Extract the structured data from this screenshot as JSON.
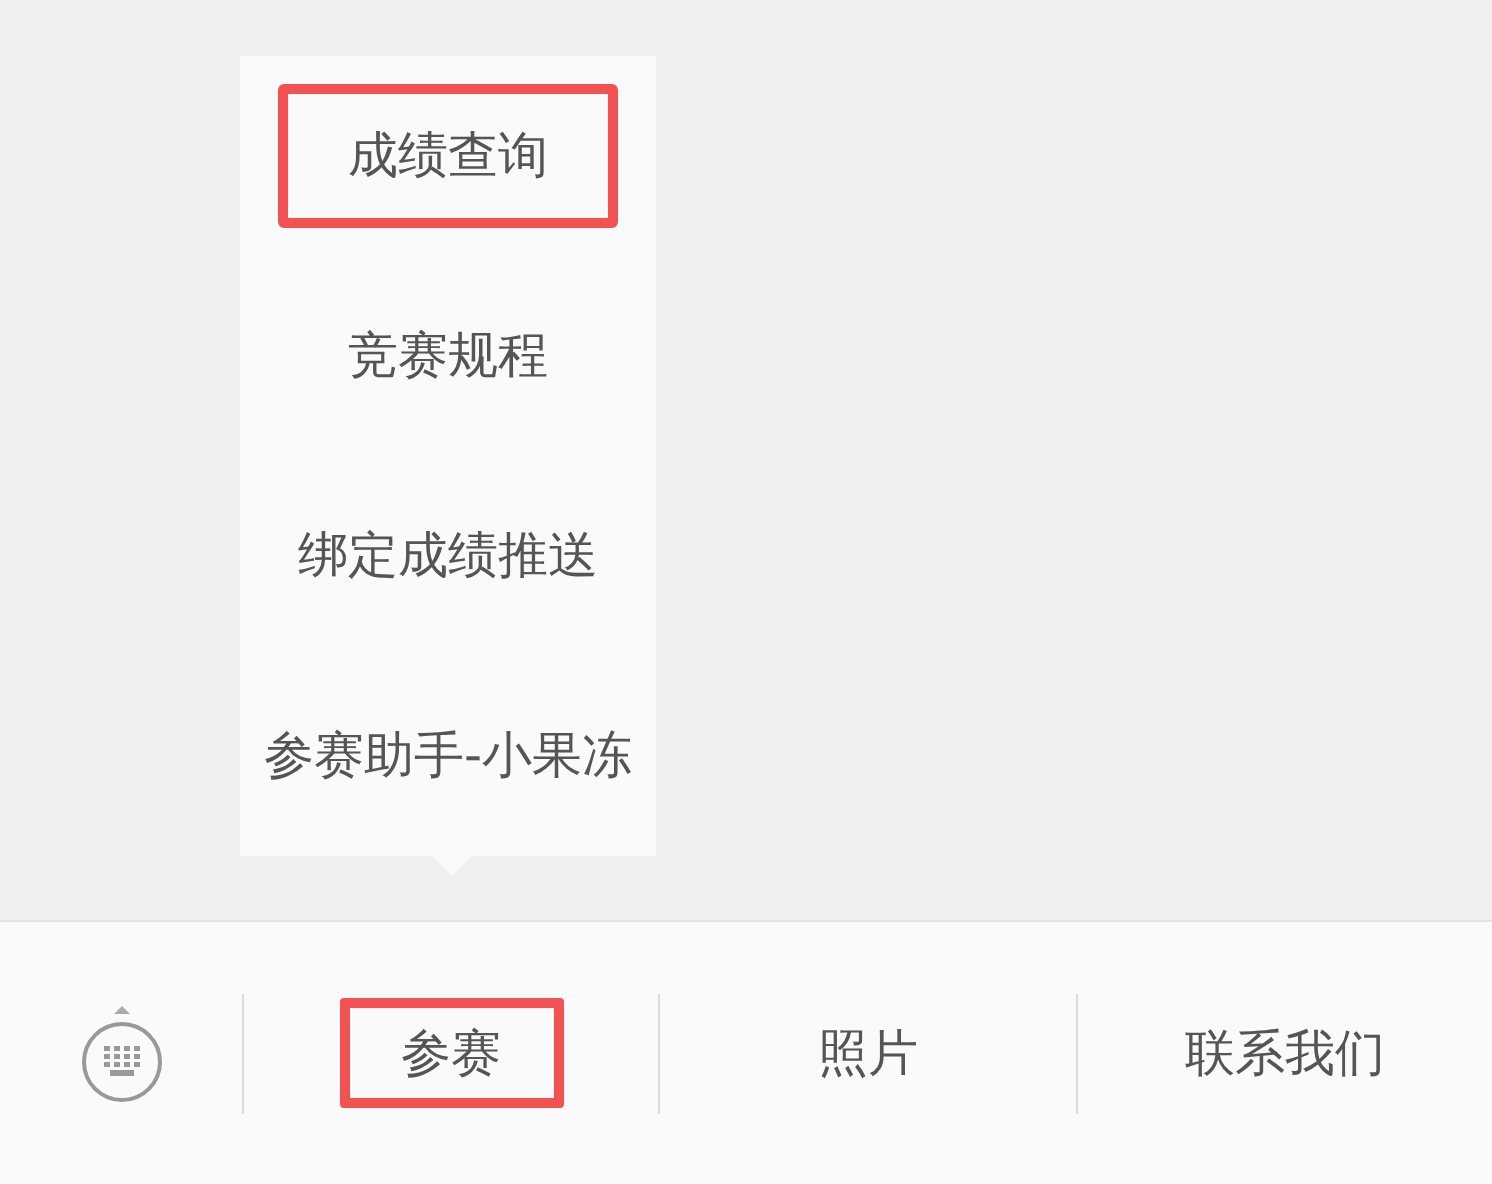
{
  "menu": {
    "items": [
      {
        "label": "成绩查询",
        "highlighted": true
      },
      {
        "label": "竞赛规程",
        "highlighted": false
      },
      {
        "label": "绑定成绩推送",
        "highlighted": false
      },
      {
        "label": "参赛助手-小果冻",
        "highlighted": false
      }
    ]
  },
  "bottom_bar": {
    "tabs": [
      {
        "label": "参赛",
        "highlighted": true
      },
      {
        "label": "照片",
        "highlighted": false
      },
      {
        "label": "联系我们",
        "highlighted": false
      }
    ]
  }
}
